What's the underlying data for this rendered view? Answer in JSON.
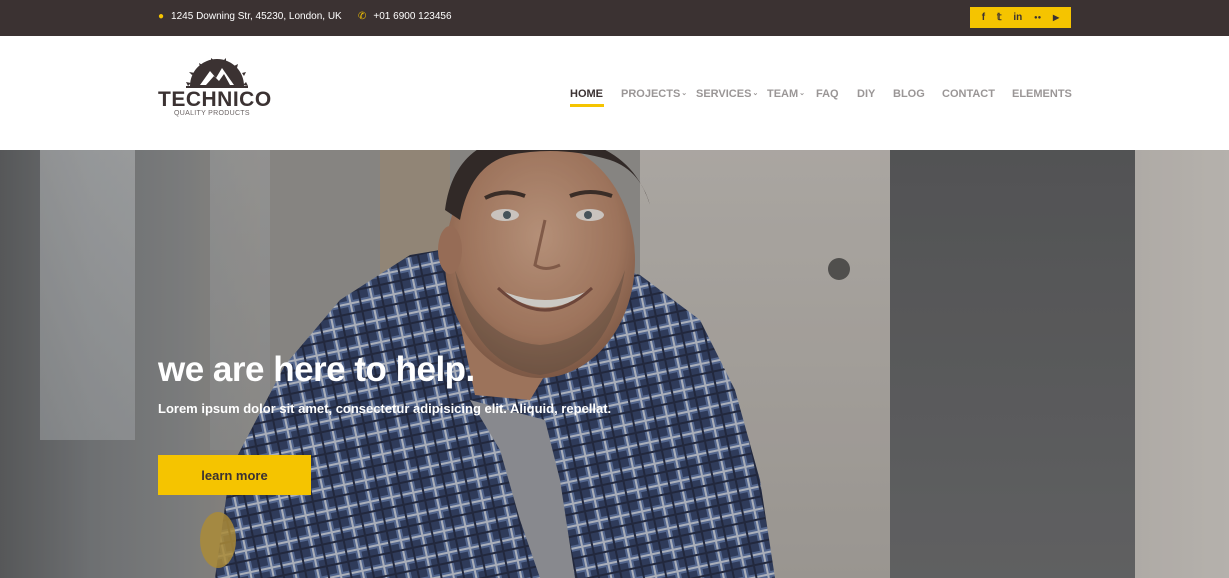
{
  "topbar": {
    "address": "1245 Downing Str, 45230, London, UK",
    "phone": "+01 6900 123456",
    "social": [
      {
        "icon": "facebook-icon",
        "glyph": "f"
      },
      {
        "icon": "twitter-icon",
        "glyph": "𝕥"
      },
      {
        "icon": "linkedin-icon",
        "glyph": "in"
      },
      {
        "icon": "flickr-icon",
        "glyph": "●●"
      },
      {
        "icon": "youtube-icon",
        "glyph": "▶"
      }
    ]
  },
  "logo": {
    "brand": "TECHNICO",
    "tagline": "QUALITY PRODUCTS"
  },
  "nav": {
    "items": [
      {
        "label": "HOME",
        "active": true
      },
      {
        "label": "PROJECTS",
        "dropdown": true
      },
      {
        "label": "SERVICES",
        "dropdown": true
      },
      {
        "label": "TEAM",
        "dropdown": true
      },
      {
        "label": "FAQ"
      },
      {
        "label": "DIY"
      },
      {
        "label": "BLOG"
      },
      {
        "label": "CONTACT"
      },
      {
        "label": "ELEMENTS"
      }
    ]
  },
  "hero": {
    "title": "we are here to help.",
    "text": "Lorem ipsum dolor sit amet, consectetur adipisicing elit. Aliquid, repellat.",
    "button": "learn more"
  },
  "colors": {
    "accent": "#f5c400",
    "dark": "#3b3232"
  }
}
